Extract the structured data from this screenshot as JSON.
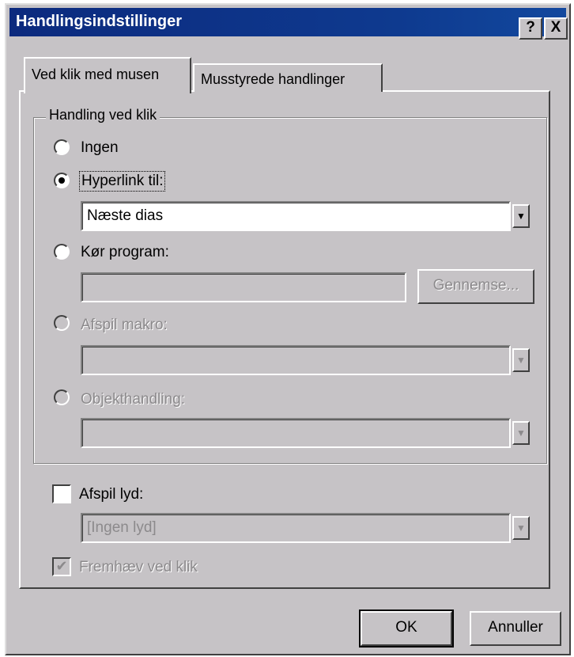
{
  "window": {
    "title": "Handlingsindstillinger",
    "help_label": "?",
    "close_label": "X"
  },
  "tabs": [
    {
      "label": "Ved klik med musen",
      "active": true
    },
    {
      "label": "Musstyrede handlinger",
      "active": false
    }
  ],
  "group": {
    "legend": "Handling ved klik",
    "options": [
      {
        "label": "Ingen",
        "selected": false,
        "enabled": true
      },
      {
        "label": "Hyperlink til:",
        "selected": true,
        "enabled": true
      },
      {
        "label": "Kør program:",
        "selected": false,
        "enabled": true
      },
      {
        "label": "Afspil makro:",
        "selected": false,
        "enabled": false
      },
      {
        "label": "Objekthandling:",
        "selected": false,
        "enabled": false
      }
    ],
    "hyperlink_value": "Næste dias",
    "program_value": "",
    "browse_label": "Gennemse...",
    "macro_value": "",
    "object_value": ""
  },
  "sound": {
    "label": "Afspil lyd:",
    "checked": false,
    "value": "[Ingen lyd]"
  },
  "highlight": {
    "label": "Fremhæv ved klik",
    "checked": true,
    "enabled": false
  },
  "buttons": {
    "ok": "OK",
    "cancel": "Annuller"
  }
}
